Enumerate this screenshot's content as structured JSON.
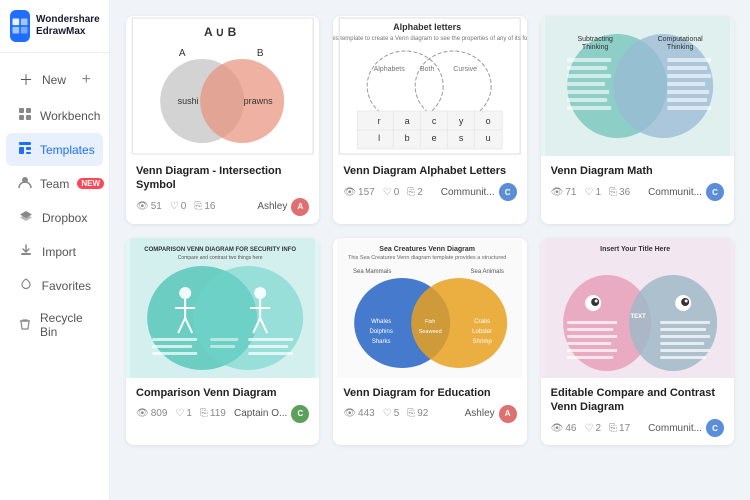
{
  "app": {
    "name": "Wondershare",
    "name2": "EdrawMax",
    "logo_color": "#1e6fff"
  },
  "sidebar": {
    "new_label": "New",
    "items": [
      {
        "id": "workbench",
        "label": "Workbench",
        "icon": "🖥",
        "active": false,
        "badge": null
      },
      {
        "id": "templates",
        "label": "Templates",
        "icon": "📋",
        "active": true,
        "badge": null
      },
      {
        "id": "team",
        "label": "Team",
        "icon": "👤",
        "active": false,
        "badge": "NEW"
      },
      {
        "id": "dropbox",
        "label": "Dropbox",
        "icon": "📦",
        "active": false,
        "badge": null
      },
      {
        "id": "import",
        "label": "Import",
        "icon": "⬇",
        "active": false,
        "badge": null
      },
      {
        "id": "favorites",
        "label": "Favorites",
        "icon": "♡",
        "active": false,
        "badge": null
      },
      {
        "id": "recycle",
        "label": "Recycle Bin",
        "icon": "🗑",
        "active": false,
        "badge": null
      }
    ]
  },
  "cards": [
    {
      "id": "card1",
      "title": "Venn Diagram - Intersection Symbol",
      "views": "51",
      "likes": "0",
      "copies": "16",
      "author_name": "Ashley",
      "author_color": "#e07070"
    },
    {
      "id": "card2",
      "title": "Venn Diagram Alphabet Letters",
      "views": "157",
      "likes": "0",
      "copies": "2",
      "author_name": "Communit...",
      "author_color": "#5b8dd9"
    },
    {
      "id": "card3",
      "title": "Venn Diagram Math",
      "views": "71",
      "likes": "1",
      "copies": "36",
      "author_name": "Communit...",
      "author_color": "#5b8dd9"
    },
    {
      "id": "card4",
      "title": "Comparison Venn Diagram",
      "views": "809",
      "likes": "1",
      "copies": "119",
      "author_name": "Captain O...",
      "author_color": "#5ba05b"
    },
    {
      "id": "card5",
      "title": "Venn Diagram for Education",
      "views": "443",
      "likes": "5",
      "copies": "92",
      "author_name": "Ashley",
      "author_color": "#e07070"
    },
    {
      "id": "card6",
      "title": "Editable Compare and Contrast Venn Diagram",
      "views": "46",
      "likes": "2",
      "copies": "17",
      "author_name": "Communit...",
      "author_color": "#5b8dd9"
    }
  ],
  "icons": {
    "eye": "👁",
    "heart": "♡",
    "copy": "⬜"
  }
}
